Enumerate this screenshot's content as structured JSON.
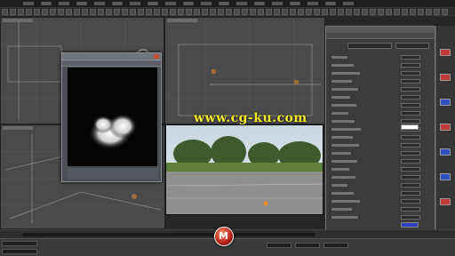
{
  "menubar": {
    "items": [
      "",
      "",
      "",
      "",
      "",
      "",
      "",
      "",
      "",
      "",
      "",
      "",
      "",
      "",
      "",
      "",
      "",
      "",
      ""
    ]
  },
  "toolbar": {
    "items": [
      "",
      "",
      "",
      "",
      "",
      "",
      "",
      "",
      "",
      "",
      "",
      "",
      "",
      "",
      "",
      "",
      "",
      "",
      "",
      "",
      "",
      "",
      "",
      "",
      "",
      "",
      "",
      "",
      "",
      "",
      "",
      "",
      "",
      "",
      "",
      "",
      "",
      "",
      "",
      "",
      "",
      "",
      "",
      "",
      "",
      "",
      "",
      "",
      "",
      "",
      "",
      "",
      "",
      "",
      "",
      ""
    ]
  },
  "viewports": {
    "top_left_label": "",
    "top_right_label": "",
    "bottom_left_label": ""
  },
  "preview_window": {
    "title": "",
    "menu": [
      "",
      "",
      ""
    ],
    "status_line1": "",
    "status_line2": ""
  },
  "material_editor": {
    "title": "",
    "menu": [
      "",
      "",
      "",
      "",
      "",
      ""
    ],
    "slot_name": "",
    "section_title": "",
    "colors": {
      "swatch_white": "#ffffff",
      "swatch_blue": "#2f3fc0"
    },
    "labels": [
      "",
      "",
      "",
      "",
      "",
      "",
      "",
      "",
      "",
      "",
      "",
      "",
      "",
      "",
      "",
      "",
      "",
      "",
      "",
      "",
      ""
    ]
  },
  "right_strip": {
    "chip_colors": [
      "#c23838",
      "#c23838",
      "#2f4fc2",
      "#c23838",
      "#2f4fc2",
      "#2f4fc2",
      "#c23838"
    ]
  },
  "timeline": {
    "frame_label": "",
    "ticks": []
  },
  "statusbar": {
    "left_text": "",
    "prompt_text": "",
    "coord_x": "",
    "coord_y": "",
    "coord_z": ""
  },
  "watermark": {
    "text": "www.cg-ku.com"
  },
  "logo": {
    "letter": "M"
  }
}
